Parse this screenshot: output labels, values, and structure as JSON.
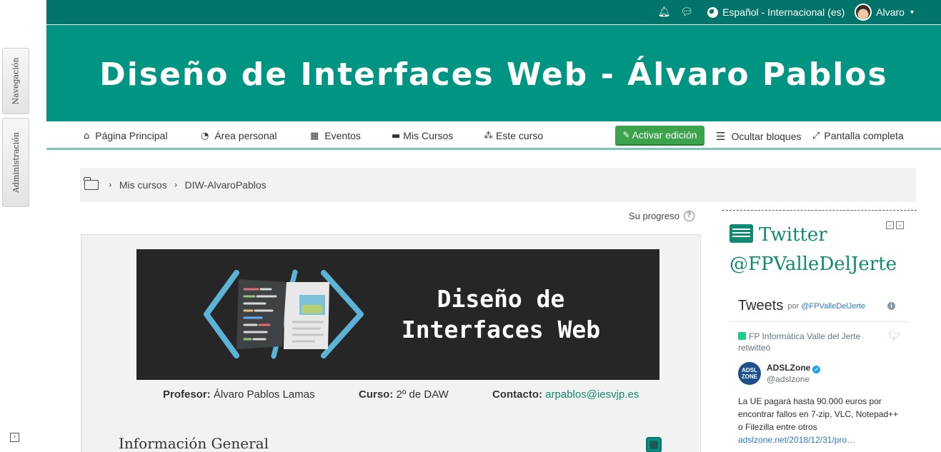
{
  "dock": {
    "navigation_tab": "Navegación",
    "administration_tab": "Administración",
    "toggle_icon": "dock-toggle-icon"
  },
  "topbar": {
    "notifications_icon": "bell-icon",
    "messages_icon": "chat-icon",
    "language": "Español - Internacional (es)",
    "user_name": "Alvaro"
  },
  "header": {
    "title": "Diseño de Interfaces Web - Álvaro Pablos"
  },
  "nav": {
    "items": [
      {
        "label": "Página Principal",
        "icon": "home-icon"
      },
      {
        "label": "Área personal",
        "icon": "dashboard-icon"
      },
      {
        "label": "Eventos",
        "icon": "calendar-icon"
      },
      {
        "label": "Mis Cursos",
        "icon": "briefcase-icon"
      },
      {
        "label": "Este curso",
        "icon": "sitemap-icon"
      }
    ],
    "edit_button": "Activar edición",
    "hide_blocks": "Ocultar bloques",
    "fullscreen": "Pantalla completa"
  },
  "breadcrumb": {
    "items": [
      "Mis cursos",
      "DIW-AlvaroPablos"
    ]
  },
  "progress": {
    "label": "Su progreso",
    "help": "?"
  },
  "course": {
    "image_title_line1": "Diseño de",
    "image_title_line2": "Interfaces Web",
    "teacher_label": "Profesor:",
    "teacher": "Álvaro Pablos Lamas",
    "course_label": "Curso:",
    "course": "2º de DAW",
    "contact_label": "Contacto:",
    "contact": "arpablos@iesvjp.es",
    "section_title": "Información General"
  },
  "block": {
    "title": "Twitter @FPValleDelJerte",
    "tweets": {
      "header": "Tweets",
      "by": "por",
      "by_handle": "@FPValleDelJerte",
      "info": "i",
      "retweeted_by": "FP Informática Valle del Jerte",
      "retweeted_suffix": "retwitteó",
      "author_name": "ADSLZone",
      "author_handle": "@adslzone",
      "avatar_text": "ADSL ZONE",
      "text": "La UE pagará hasta 90.000 euros por encontrar fallos en 7-zip, VLC, Notepad++ o Filezilla entre otros",
      "link": "adslzone.net/2018/12/31/pro…"
    }
  },
  "colors": {
    "topbar": "#00736a",
    "banner": "#009583",
    "accent": "#0f8a72",
    "edit_button": "#3aa34b"
  }
}
